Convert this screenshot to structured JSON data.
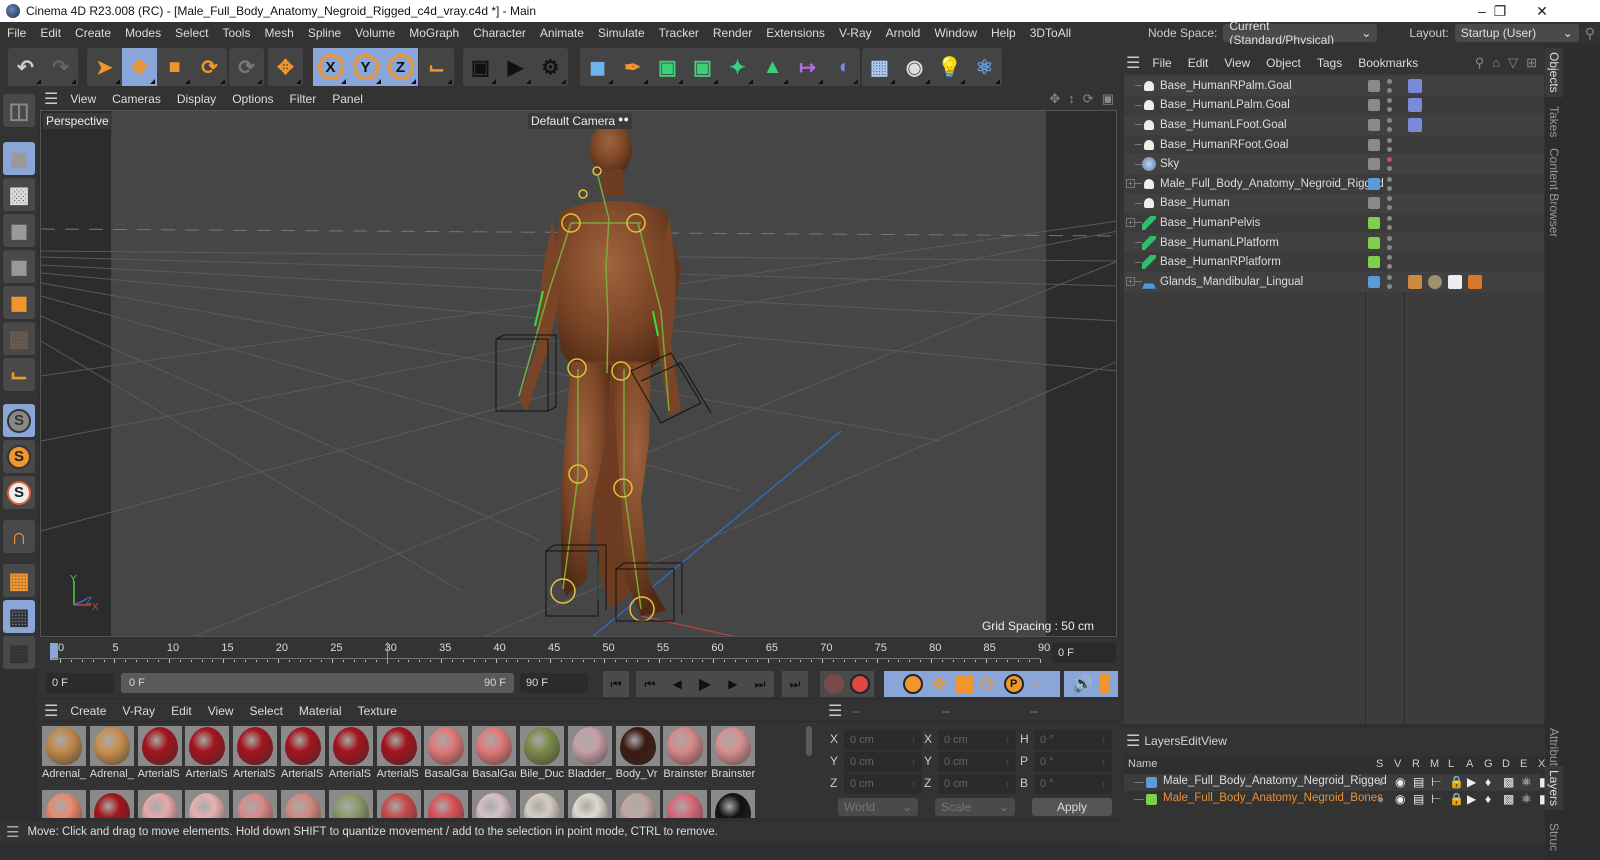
{
  "window": {
    "title": "Cinema 4D R23.008 (RC) - [Male_Full_Body_Anatomy_Negroid_Rigged_c4d_vray.c4d *] - Main",
    "minimize_icon": "minimize-icon",
    "restore_icon": "restore-icon",
    "close_icon": "close-icon"
  },
  "menu": [
    "File",
    "Edit",
    "Create",
    "Modes",
    "Select",
    "Tools",
    "Mesh",
    "Spline",
    "Volume",
    "MoGraph",
    "Character",
    "Animate",
    "Simulate",
    "Tracker",
    "Render",
    "Extensions",
    "V-Ray",
    "Arnold",
    "Window",
    "Help",
    "3DToAll"
  ],
  "node_space": {
    "label": "Node Space:",
    "value": "Current (Standard/Physical)"
  },
  "layout": {
    "label": "Layout:",
    "value": "Startup (User)"
  },
  "toolbar": {
    "groups": [
      [
        "undo-icon",
        "redo-icon"
      ],
      [
        "select-live-icon",
        "move-icon",
        "scale-icon",
        "rotate-icon"
      ],
      [
        "psr-icon"
      ],
      [
        "axis-move-icon"
      ],
      [
        "x-axis-icon",
        "y-axis-icon",
        "z-axis-icon"
      ],
      [
        "coordinate-system-icon"
      ],
      [
        "render-view-icon",
        "render-picture-viewer-icon",
        "render-settings-icon"
      ],
      [
        "cube-icon",
        "pen-icon",
        "subdivision-icon",
        "extrude-icon",
        "mograph-cloner-icon",
        "array-icon",
        "deformer-icon",
        "bend-icon"
      ],
      [
        "floor-icon",
        "camera-icon",
        "light-icon",
        "python-icon"
      ]
    ],
    "active": [
      "move-icon",
      "x-axis-icon",
      "y-axis-icon",
      "z-axis-icon"
    ]
  },
  "left_toolbar": [
    "make-editable-icon",
    "model-mode-icon",
    "texture-mode-icon",
    "points-mode-icon",
    "edges-mode-icon",
    "polygons-mode-icon",
    "uv-mode-icon",
    "axis-mode-icon",
    "snap-enabled-icon",
    "snap-settings-icon",
    "snap-mode-icon",
    "magnet-icon",
    "workplane-icon",
    "locked-workplane-icon",
    "workplane-rotate-icon"
  ],
  "viewport": {
    "menu": [
      "View",
      "Cameras",
      "Display",
      "Options",
      "Filter",
      "Panel"
    ],
    "label": "Perspective",
    "camera": "Default Camera",
    "grid_spacing": "Grid Spacing : 50 cm",
    "axis_labels": {
      "x": "X",
      "y": "Y",
      "z": "Z"
    }
  },
  "timeline": {
    "ticks": [
      "0",
      "5",
      "10",
      "15",
      "20",
      "25",
      "30",
      "35",
      "40",
      "45",
      "50",
      "55",
      "60",
      "65",
      "70",
      "75",
      "80",
      "85",
      "90"
    ],
    "current_frame": "0 F",
    "start_field": "0 F",
    "range_start": "0 F",
    "range_end": "90 F",
    "end_field": "90 F",
    "playhead_fraction": 0
  },
  "materials": {
    "menu": [
      "Create",
      "V-Ray",
      "Edit",
      "View",
      "Select",
      "Material",
      "Texture"
    ],
    "row1": [
      {
        "name": "Adrenal_",
        "color": "#c08a4a"
      },
      {
        "name": "Adrenal_",
        "color": "#c89050"
      },
      {
        "name": "ArterialS",
        "color": "#a3141c"
      },
      {
        "name": "ArterialS",
        "color": "#a3141c"
      },
      {
        "name": "ArterialS",
        "color": "#a3141c"
      },
      {
        "name": "ArterialS",
        "color": "#a3141c"
      },
      {
        "name": "ArterialS",
        "color": "#a3141c"
      },
      {
        "name": "ArterialS",
        "color": "#a3141c"
      },
      {
        "name": "BasalGar",
        "color": "#e07a78"
      },
      {
        "name": "BasalGar",
        "color": "#e07a78"
      },
      {
        "name": "Bile_Duc",
        "color": "#7c8a4a"
      },
      {
        "name": "Bladder_",
        "color": "#c8a0a8"
      },
      {
        "name": "Body_Vr",
        "color": "#3a1a10"
      },
      {
        "name": "Brainster",
        "color": "#d88888"
      },
      {
        "name": "Brainster",
        "color": "#d89090"
      }
    ],
    "row2": [
      "#e88a70",
      "#a3141c",
      "#e8a8a8",
      "#e8b0b0",
      "#d88a88",
      "#d08a80",
      "#8a9a6a",
      "#c84848",
      "#d85058",
      "#d8c0c8",
      "#d8ccc0",
      "#e0d8cc",
      "#c0a8a0",
      "#d86878",
      "#111111"
    ]
  },
  "coordinates": {
    "headers": [
      "--",
      "--",
      "--"
    ],
    "position": [
      {
        "axis": "X",
        "value": "0 cm"
      },
      {
        "axis": "Y",
        "value": "0 cm"
      },
      {
        "axis": "Z",
        "value": "0 cm"
      }
    ],
    "size": [
      {
        "axis": "X",
        "value": "0 cm"
      },
      {
        "axis": "Y",
        "value": "0 cm"
      },
      {
        "axis": "Z",
        "value": "0 cm"
      }
    ],
    "rotation": [
      {
        "axis": "H",
        "value": "0 °"
      },
      {
        "axis": "P",
        "value": "0 °"
      },
      {
        "axis": "B",
        "value": "0 °"
      }
    ],
    "mode": "World",
    "size_mode": "Scale",
    "apply_label": "Apply"
  },
  "objects": {
    "menu": [
      "File",
      "Edit",
      "View",
      "Object",
      "Tags",
      "Bookmarks"
    ],
    "items": [
      {
        "name": "Base_HumanRPalm.Goal",
        "icon": "null-icon",
        "toggle": "gray",
        "expand": false,
        "tags": [
          "ik-goal-tag-icon"
        ]
      },
      {
        "name": "Base_HumanLPalm.Goal",
        "icon": "null-icon",
        "toggle": "gray",
        "expand": false,
        "tags": [
          "ik-goal-tag-icon"
        ]
      },
      {
        "name": "Base_HumanLFoot.Goal",
        "icon": "null-icon",
        "toggle": "gray",
        "expand": false,
        "tags": [
          "ik-goal-tag-icon"
        ]
      },
      {
        "name": "Base_HumanRFoot.Goal",
        "icon": "null-icon",
        "toggle": "gray",
        "expand": false,
        "tags": []
      },
      {
        "name": "Sky",
        "icon": "sky-icon",
        "toggle": "gray",
        "expand": false,
        "tags": [],
        "red_dot": true
      },
      {
        "name": "Male_Full_Body_Anatomy_Negroid_Rigged",
        "icon": "null-icon",
        "toggle": "blue",
        "expand": true,
        "tags": []
      },
      {
        "name": "Base_Human",
        "icon": "null-icon",
        "toggle": "gray",
        "expand": false,
        "tags": []
      },
      {
        "name": "Base_HumanPelvis",
        "icon": "joint-icon",
        "toggle": "green",
        "expand": true,
        "tags": []
      },
      {
        "name": "Base_HumanLPlatform",
        "icon": "joint-icon",
        "toggle": "green",
        "expand": false,
        "tags": []
      },
      {
        "name": "Base_HumanRPlatform",
        "icon": "joint-icon",
        "toggle": "green",
        "expand": false,
        "tags": []
      },
      {
        "name": "Glands_Mandibular_Lingual",
        "icon": "polygon-object-icon",
        "toggle": "blue",
        "expand": true,
        "tags": [
          "vray-tag-icon",
          "material-tag-icon",
          "texture-tag-icon",
          "weight-tag-icon"
        ]
      }
    ]
  },
  "layers": {
    "menu": [
      "Layers",
      "Edit",
      "View"
    ],
    "columns": [
      "Name",
      "S",
      "V",
      "R",
      "M",
      "L",
      "A",
      "G",
      "D",
      "E",
      "X"
    ],
    "items": [
      {
        "name": "Male_Full_Body_Anatomy_Negroid_Rigged",
        "color": "#5b9bd8",
        "text_color": "#dddddd"
      },
      {
        "name": "Male_Full_Body_Anatomy_Negroid_Bones",
        "color": "#7ed04a",
        "text_color": "#e8913a"
      }
    ]
  },
  "side_tabs": {
    "top": [
      "Objects",
      "Takes",
      "Content Browser"
    ],
    "bottom": [
      "Attributes",
      "Layers",
      "Structure"
    ]
  },
  "status": "Move: Click and drag to move elements. Hold down SHIFT to quantize movement / add to the selection in point mode, CTRL to remove.",
  "colors": {
    "accent": "#8aa6d8",
    "orange": "#f0962c",
    "panel": "#333333",
    "viewport": "#3c3c3c"
  }
}
